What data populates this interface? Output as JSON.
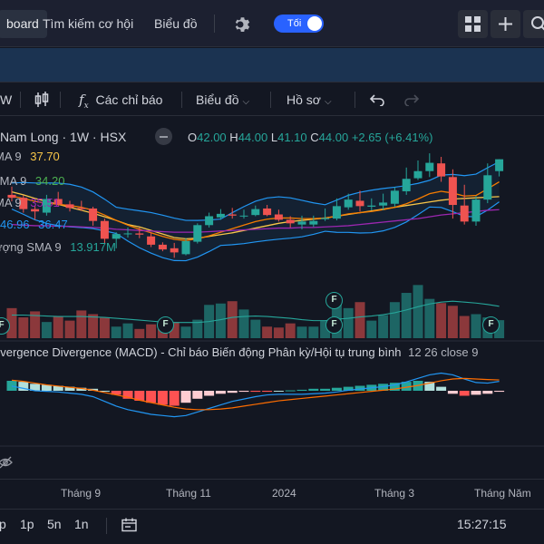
{
  "topbar": {
    "tab_dashboard": "board",
    "tab_opportunities": "Tìm kiếm cơ hội",
    "tab_charts": "Biểu đồ",
    "settings_icon": "gear-icon",
    "theme_toggle_label": "Tối",
    "layout_icon": "grid-icon",
    "add_icon": "plus-icon"
  },
  "toolbar": {
    "interval": "W",
    "candle_icon": "candlestick-icon",
    "indicators_label": "Các chỉ báo",
    "chart_type_label": "Biểu đồ",
    "profile_label": "Hồ sơ",
    "undo_icon": "undo-icon",
    "redo_icon": "redo-icon"
  },
  "symbol": {
    "name": "Nam Long",
    "interval": "1W",
    "exchange": "HSX",
    "o_label": "O",
    "o": "42.00",
    "h_label": "H",
    "h": "44.00",
    "l_label": "L",
    "l": "41.10",
    "c_label": "C",
    "c": "44.00",
    "change": "+2.65 (+6.41%)"
  },
  "indicators": {
    "ma1_label": "MA 9",
    "ma1_value": "37.70",
    "ma2_label": "SMA 9",
    "ma2_value": "34.20",
    "ma3_label": "MA 9",
    "ma3_value": "35.51",
    "bb_value1": "46.96",
    "bb_value2": "36.47",
    "vol_label": "ượng SMA 9",
    "vol_value": "13.917M"
  },
  "macd": {
    "title": "overgence Divergence (MACD) - Chỉ báo Biến động Phân kỳ/Hội tụ trung bình",
    "params": "12 26 close 9"
  },
  "xaxis": {
    "labels": [
      "Tháng 9",
      "Tháng 11",
      "2024",
      "Tháng 3",
      "Tháng Năm"
    ]
  },
  "bottombar": {
    "range_partial": "p",
    "range_1p": "1p",
    "range_5n": "5n",
    "range_1n": "1n",
    "time": "15:27:15 (UTC-"
  },
  "colors": {
    "up": "#26a69a",
    "down": "#ef5350",
    "accent": "#2962ff"
  },
  "chart_data": {
    "type": "candlestick",
    "x": [
      "2023-07-17",
      "2023-07-24",
      "2023-07-31",
      "2023-08-07",
      "2023-08-14",
      "2023-08-21",
      "2023-08-28",
      "2023-09-04",
      "2023-09-11",
      "2023-09-18",
      "2023-09-25",
      "2023-10-02",
      "2023-10-09",
      "2023-10-16",
      "2023-10-23",
      "2023-10-30",
      "2023-11-06",
      "2023-11-13",
      "2023-11-20",
      "2023-11-27",
      "2023-12-04",
      "2023-12-11",
      "2023-12-18",
      "2023-12-25",
      "2024-01-01",
      "2024-01-08",
      "2024-01-15",
      "2024-01-22",
      "2024-01-29",
      "2024-02-05",
      "2024-02-19",
      "2024-02-26",
      "2024-03-04",
      "2024-03-11",
      "2024-03-18",
      "2024-03-25",
      "2024-04-01",
      "2024-04-08",
      "2024-04-15",
      "2024-04-22",
      "2024-04-29",
      "2024-05-06",
      "2024-05-13"
    ],
    "open": [
      38.0,
      37.5,
      35.6,
      35.0,
      37.3,
      36.4,
      35.8,
      35.7,
      33.6,
      30.6,
      31.4,
      31.5,
      31.0,
      29.6,
      29.0,
      28.0,
      30.1,
      32.9,
      34.2,
      34.7,
      34.5,
      34.6,
      35.7,
      34.7,
      33.8,
      33.0,
      33.0,
      33.9,
      34.0,
      35.9,
      37.0,
      36.0,
      36.2,
      36.5,
      38.6,
      40.8,
      42.0,
      43.3,
      41.0,
      36.2,
      33.5,
      37.2,
      42.0
    ],
    "high": [
      39.4,
      37.9,
      36.2,
      38.0,
      38.5,
      37.0,
      37.0,
      36.0,
      34.0,
      31.7,
      32.5,
      32.5,
      31.6,
      30.0,
      29.9,
      30.7,
      33.2,
      35.0,
      35.6,
      35.8,
      35.5,
      36.2,
      36.3,
      35.5,
      34.4,
      34.5,
      34.5,
      35.7,
      37.4,
      38.2,
      38.7,
      37.4,
      38.2,
      39.3,
      42.6,
      43.8,
      45.0,
      44.4,
      42.3,
      39.7,
      37.8,
      43.3,
      44.0
    ],
    "low": [
      36.9,
      35.0,
      33.8,
      34.5,
      36.0,
      35.2,
      35.3,
      32.8,
      29.8,
      29.0,
      30.8,
      30.7,
      29.2,
      28.5,
      27.4,
      27.8,
      29.8,
      32.5,
      33.8,
      34.0,
      34.0,
      34.4,
      34.4,
      33.5,
      32.5,
      32.2,
      32.6,
      33.6,
      33.7,
      35.5,
      35.2,
      35.4,
      35.4,
      36.0,
      38.0,
      40.5,
      41.0,
      40.2,
      34.0,
      33.0,
      32.8,
      36.6,
      41.1
    ],
    "close": [
      37.5,
      35.6,
      35.2,
      37.3,
      36.4,
      35.8,
      35.6,
      33.6,
      30.6,
      31.4,
      31.5,
      31.3,
      29.6,
      28.8,
      28.3,
      30.2,
      32.9,
      34.4,
      34.8,
      34.5,
      34.5,
      35.6,
      34.6,
      33.8,
      33.2,
      33.5,
      33.6,
      34.1,
      36.1,
      37.2,
      36.1,
      36.2,
      36.7,
      38.7,
      40.7,
      42.0,
      43.4,
      41.1,
      36.3,
      33.5,
      37.2,
      41.3,
      44.0
    ],
    "ylim": [
      25,
      47
    ],
    "ma_series": [
      {
        "color": "#f7c548",
        "values": [
          38.5,
          38.0,
          37.4,
          36.9,
          36.4,
          35.9,
          35.4,
          34.9,
          34.3,
          33.7,
          33.0,
          32.6,
          32.0,
          31.4,
          30.8,
          30.6,
          30.7,
          31.0,
          31.3,
          31.6,
          32.0,
          32.4,
          32.8,
          33.2,
          33.5,
          33.7,
          33.9,
          34.1,
          34.4,
          34.7,
          35.0,
          35.3,
          35.6,
          35.9,
          36.2,
          36.5,
          36.8,
          37.1,
          37.3,
          37.4,
          37.5,
          37.6,
          37.7
        ]
      },
      {
        "color": "#f57c00",
        "values": [
          37.8,
          37.4,
          36.9,
          36.6,
          36.4,
          36.2,
          35.9,
          35.4,
          34.6,
          33.7,
          32.9,
          32.2,
          31.6,
          31.0,
          30.5,
          30.3,
          30.6,
          31.1,
          31.7,
          32.3,
          32.9,
          33.5,
          33.9,
          34.1,
          34.1,
          34.0,
          34.0,
          34.1,
          34.4,
          34.8,
          35.0,
          35.2,
          35.5,
          35.9,
          36.5,
          37.3,
          38.2,
          38.6,
          38.3,
          37.8,
          37.9,
          39.0,
          40.2
        ]
      },
      {
        "color": "#9c27b0",
        "values": [
          33.0,
          32.9,
          32.8,
          32.8,
          32.7,
          32.7,
          32.6,
          32.5,
          32.4,
          32.2,
          32.1,
          32.0,
          31.9,
          31.8,
          31.7,
          31.7,
          31.7,
          31.8,
          31.9,
          32.0,
          32.1,
          32.2,
          32.3,
          32.4,
          32.4,
          32.5,
          32.5,
          32.6,
          32.7,
          32.8,
          33.0,
          33.2,
          33.4,
          33.6,
          33.8,
          34.0,
          34.3,
          34.6,
          34.8,
          35.0,
          35.2,
          35.4,
          35.5
        ]
      }
    ],
    "volume": [
      6.5,
      4.5,
      5.8,
      3.5,
      4.8,
      3.8,
      6.0,
      5.2,
      4.4,
      2.5,
      3.2,
      2.0,
      3.0,
      2.2,
      3.5,
      2.5,
      4.0,
      7.2,
      7.5,
      8.0,
      6.2,
      4.0,
      2.5,
      2.3,
      3.2,
      2.5,
      2.5,
      3.8,
      7.5,
      6.5,
      7.8,
      3.8,
      5.0,
      7.8,
      9.8,
      11.5,
      8.5,
      7.6,
      7.0,
      4.8,
      5.2,
      4.5,
      3.9
    ],
    "volume_ma": [
      5.0,
      5.0,
      4.9,
      4.8,
      4.7,
      4.7,
      4.7,
      4.6,
      4.5,
      4.3,
      4.1,
      3.9,
      3.7,
      3.5,
      3.4,
      3.4,
      3.4,
      3.6,
      4.0,
      4.5,
      4.7,
      4.8,
      4.7,
      4.5,
      4.3,
      4.0,
      3.8,
      3.8,
      4.1,
      4.3,
      4.6,
      4.8,
      5.1,
      5.5,
      6.1,
      6.8,
      7.4,
      7.8,
      8.0,
      7.8,
      7.6,
      7.3,
      6.9
    ],
    "macd": [
      0.4,
      0.2,
      0.0,
      -0.05,
      -0.1,
      -0.2,
      -0.3,
      -0.5,
      -0.9,
      -1.3,
      -1.6,
      -1.8,
      -2.0,
      -2.1,
      -2.2,
      -2.1,
      -1.8,
      -1.5,
      -1.2,
      -0.9,
      -0.7,
      -0.5,
      -0.35,
      -0.3,
      -0.3,
      -0.3,
      -0.25,
      -0.2,
      -0.1,
      0.05,
      0.15,
      0.25,
      0.35,
      0.5,
      0.75,
      1.05,
      1.35,
      1.5,
      1.35,
      1.0,
      0.7,
      0.65,
      0.8
    ],
    "signal": [
      0.9,
      0.8,
      0.65,
      0.5,
      0.4,
      0.3,
      0.2,
      0.05,
      -0.15,
      -0.35,
      -0.55,
      -0.8,
      -1.0,
      -1.2,
      -1.4,
      -1.55,
      -1.6,
      -1.6,
      -1.55,
      -1.45,
      -1.3,
      -1.15,
      -1.0,
      -0.85,
      -0.75,
      -0.65,
      -0.55,
      -0.45,
      -0.35,
      -0.25,
      -0.15,
      -0.05,
      0.05,
      0.15,
      0.3,
      0.45,
      0.65,
      0.85,
      1.0,
      1.05,
      1.0,
      0.95,
      0.92
    ],
    "histogram": [
      0.5,
      0.45,
      0.35,
      0.3,
      0.25,
      0.2,
      0.15,
      0.1,
      0.0,
      -0.2,
      -0.4,
      -0.5,
      -0.6,
      -0.7,
      -0.75,
      -0.6,
      -0.4,
      -0.25,
      -0.15,
      -0.1,
      -0.05,
      -0.05,
      -0.05,
      0.0,
      0.02,
      0.05,
      0.1,
      0.1,
      0.15,
      0.2,
      0.25,
      0.3,
      0.35,
      0.4,
      0.45,
      0.5,
      0.45,
      0.2,
      -0.15,
      -0.25,
      -0.2,
      -0.15,
      -0.05
    ]
  }
}
